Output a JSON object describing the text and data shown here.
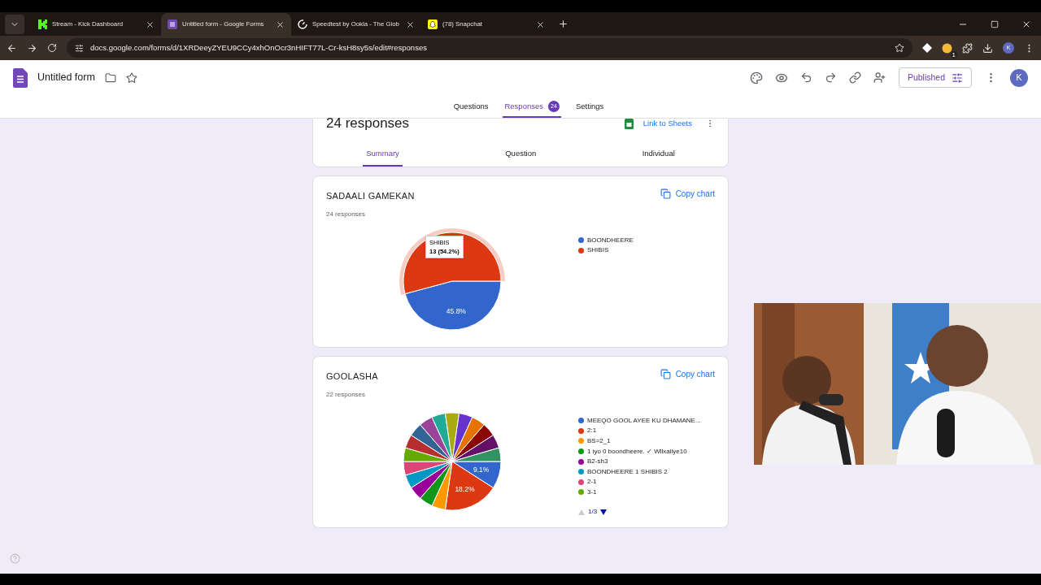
{
  "browser": {
    "tabs": [
      {
        "title": "Stream - Kick Dashboard",
        "selected": false
      },
      {
        "title": "Untitled form - Google Forms",
        "selected": true
      },
      {
        "title": "Speedtest by Ookla - The Glob",
        "selected": false
      },
      {
        "title": "(78) Snapchat",
        "selected": false
      }
    ],
    "url": "docs.google.com/forms/d/1XRDeeyZYEU9CCy4xhOnOcr3nHIFT77L-Cr-ksH8sy5s/edit#responses",
    "extension_badge": "1",
    "profile_initial": "K"
  },
  "form": {
    "title": "Untitled form",
    "publish_button": "Published",
    "avatar_initial": "K",
    "nav": [
      {
        "label": "Questions",
        "selected": false
      },
      {
        "label": "Responses",
        "selected": true,
        "count": "24"
      },
      {
        "label": "Settings",
        "selected": false
      }
    ]
  },
  "responses": {
    "heading": "24 responses",
    "link_to_sheets": "Link to Sheets",
    "view_tabs": [
      {
        "label": "Summary",
        "selected": true
      },
      {
        "label": "Question",
        "selected": false
      },
      {
        "label": "Individual",
        "selected": false
      }
    ]
  },
  "questions": [
    {
      "title": "SADAALI GAMEKAN",
      "count": "24 responses",
      "copy_label": "Copy chart",
      "legend": [
        {
          "label": "BOONDHEERE",
          "color": "#3366cc",
          "hovered": false
        },
        {
          "label": "SHIBIS",
          "color": "#dc3912",
          "hovered": true
        }
      ],
      "tooltip": {
        "title": "SHIBIS",
        "value": "13 (54.2%)"
      },
      "chart_data": {
        "type": "pie",
        "colors": [
          "#3366cc",
          "#dc3912"
        ],
        "series": [
          {
            "values": [
              45.8,
              54.2
            ]
          }
        ],
        "value_labels": [
          "45.8%",
          null
        ]
      }
    },
    {
      "title": "GOOLASHA",
      "count": "22 responses",
      "copy_label": "Copy chart",
      "legend": [
        {
          "label": "MEEQO GOOL AYEE KU DHAMANE...",
          "color": "#3366cc",
          "hovered": false
        },
        {
          "label": "2:1",
          "color": "#dc3912",
          "hovered": false
        },
        {
          "label": "BS=2_1",
          "color": "#ff9900",
          "hovered": false
        },
        {
          "label": "1 iyo 0 boondheere. ✓ Wllxaliye10",
          "color": "#109618",
          "hovered": false
        },
        {
          "label": "B2-sh3",
          "color": "#990099",
          "hovered": false
        },
        {
          "label": "BOONDHEERE 1 SHIBIS 2",
          "color": "#0099c6",
          "hovered": false
        },
        {
          "label": "2-1",
          "color": "#dd4477",
          "hovered": false
        },
        {
          "label": "3-1",
          "color": "#66aa00",
          "hovered": false
        }
      ],
      "pager": "1/3",
      "chart_data": {
        "type": "pie",
        "colors": [
          "#3366cc",
          "#dc3912",
          "#ff9900",
          "#109618",
          "#990099",
          "#0099c6",
          "#dd4477",
          "#66aa00",
          "#b82e2e",
          "#316395",
          "#994499",
          "#22aa99",
          "#aaaa11",
          "#6633cc",
          "#e67300",
          "#8b0707",
          "#651067",
          "#329262"
        ],
        "series": [
          {
            "values": [
              9.1,
              18.2,
              4.55,
              4.55,
              4.55,
              4.55,
              4.55,
              4.55,
              4.55,
              4.55,
              4.55,
              4.55,
              4.55,
              4.55,
              4.55,
              4.55,
              4.55,
              4.55
            ]
          }
        ],
        "value_labels": [
          "9.1%",
          "18.2%",
          null,
          null,
          null,
          null,
          null,
          null,
          null,
          null,
          null,
          null,
          null,
          null,
          null,
          null,
          null,
          null
        ]
      }
    }
  ]
}
